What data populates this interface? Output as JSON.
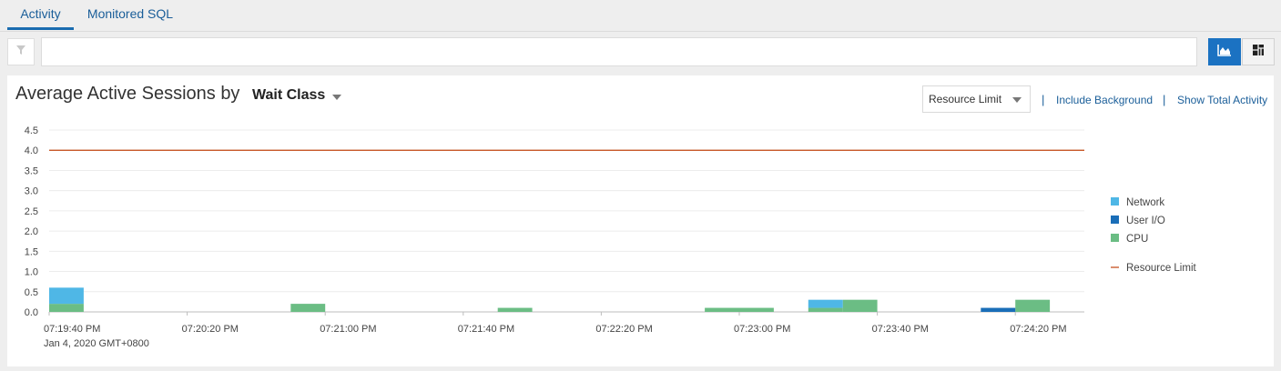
{
  "tabs": [
    {
      "label": "Activity",
      "active": true
    },
    {
      "label": "Monitored SQL",
      "active": false
    }
  ],
  "filter": {
    "value": "",
    "placeholder": ""
  },
  "view_toggle": {
    "chart_icon": "area-chart-icon",
    "table_icon": "treemap-icon",
    "selected": "chart"
  },
  "panel": {
    "title": "Average Active Sessions by",
    "dimension": "Wait Class",
    "resource_select": "Resource Limit",
    "separator": "|",
    "include_background": "Include Background",
    "show_total_activity": "Show Total Activity"
  },
  "colors": {
    "Network": "#4fb7e6",
    "User I/O": "#1a6eb8",
    "CPU": "#6bbd84",
    "Resource Limit": "#c1440e",
    "accent": "#1b72c2",
    "link": "#1a5e99"
  },
  "chart_data": {
    "type": "area",
    "title": "Average Active Sessions by Wait Class",
    "xlabel": "",
    "ylabel": "",
    "ylim": [
      0,
      4.5
    ],
    "yticks": [
      "0.0",
      "0.5",
      "1.0",
      "1.5",
      "2.0",
      "2.5",
      "3.0",
      "3.5",
      "4.0",
      "4.5"
    ],
    "x_ticks": [
      "07:19:40 PM",
      "07:20:20 PM",
      "07:21:00 PM",
      "07:21:40 PM",
      "07:22:20 PM",
      "07:23:00 PM",
      "07:23:40 PM",
      "07:24:20 PM"
    ],
    "x_sublabel": "Jan 4, 2020 GMT+0800",
    "x_start": "07:19:40 PM",
    "x_end": "07:24:40 PM",
    "bucket_seconds": 10,
    "series": [
      {
        "name": "CPU",
        "stack_order": 0,
        "values": [
          {
            "t": "07:19:40 PM",
            "v": 0.2
          },
          {
            "t": "07:20:50 PM",
            "v": 0.2
          },
          {
            "t": "07:21:50 PM",
            "v": 0.1
          },
          {
            "t": "07:22:50 PM",
            "v": 0.1
          },
          {
            "t": "07:23:00 PM",
            "v": 0.1
          },
          {
            "t": "07:23:20 PM",
            "v": 0.1
          },
          {
            "t": "07:23:30 PM",
            "v": 0.3
          },
          {
            "t": "07:24:20 PM",
            "v": 0.3
          }
        ]
      },
      {
        "name": "User I/O",
        "stack_order": 1,
        "values": [
          {
            "t": "07:24:10 PM",
            "v": 0.1
          }
        ]
      },
      {
        "name": "Network",
        "stack_order": 2,
        "values": [
          {
            "t": "07:19:40 PM",
            "v": 0.4
          },
          {
            "t": "07:23:20 PM",
            "v": 0.2
          }
        ]
      }
    ],
    "reference_lines": [
      {
        "name": "Resource Limit",
        "value": 4.0
      }
    ],
    "legend": {
      "position": "right",
      "items": [
        {
          "name": "Network",
          "kind": "box"
        },
        {
          "name": "User I/O",
          "kind": "box"
        },
        {
          "name": "CPU",
          "kind": "box"
        },
        {
          "name": "Resource Limit",
          "kind": "line"
        }
      ]
    },
    "grid": true
  }
}
